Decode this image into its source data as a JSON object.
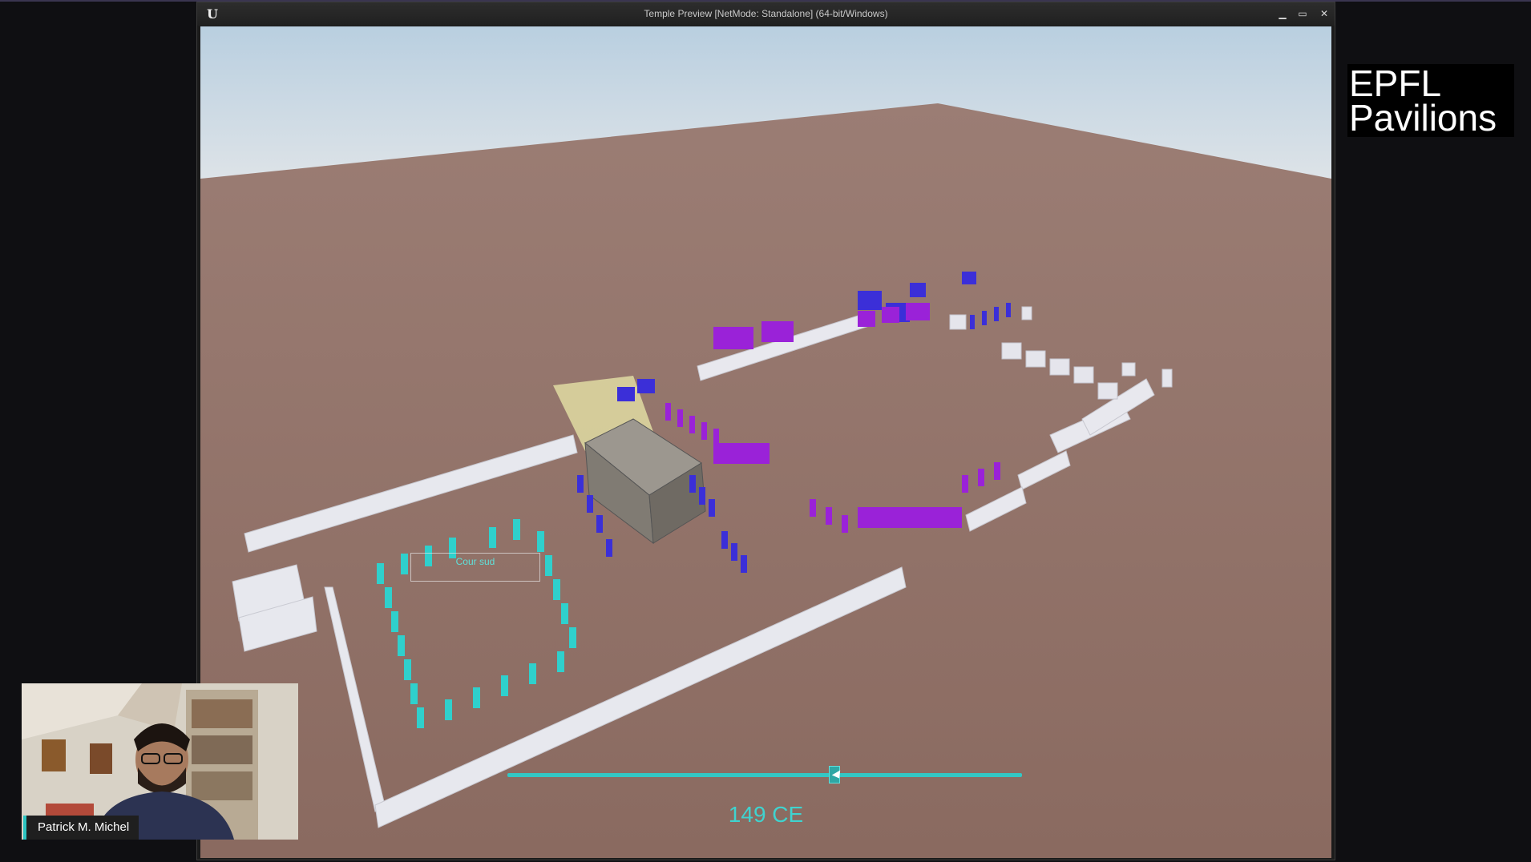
{
  "window": {
    "title": "Temple Preview [NetMode: Standalone]  (64-bit/Windows)",
    "logo_glyph": "U",
    "controls": {
      "minimize": "▁",
      "maximize": "▭",
      "close": "✕"
    }
  },
  "viewport": {
    "label_court": "Cour sud",
    "timeline": {
      "year_label": "149 CE",
      "slider_position_fraction": 0.63
    },
    "colors": {
      "ground": "#8e6f66",
      "sky": "#c7d6e0",
      "walls": "#e6e6ec",
      "columns_teal": "#2fd0cc",
      "columns_blue": "#3d2ed6",
      "columns_purple": "#9a22d8",
      "temple": "#8a857d",
      "plan_overlay": "#e2dca0"
    }
  },
  "brand": {
    "line1": "EPFL",
    "line2": "Pavilions"
  },
  "webcam": {
    "speaker_name": "Patrick M. Michel",
    "accent": "#2bc3c0"
  }
}
